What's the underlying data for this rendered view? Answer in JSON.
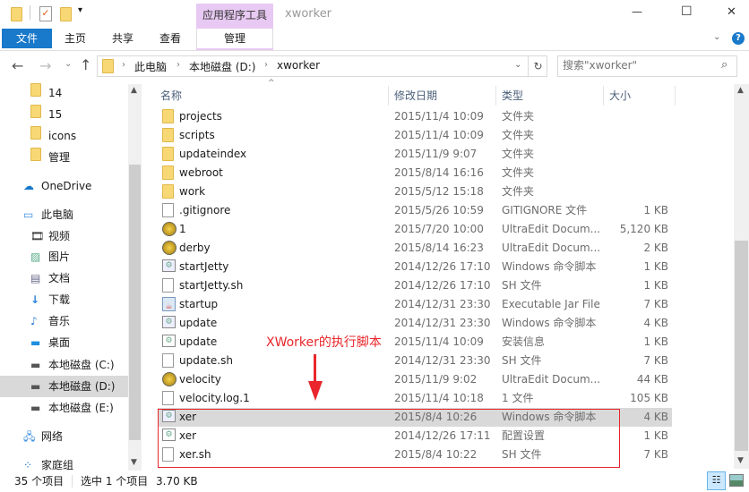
{
  "window": {
    "title": "xworker",
    "context_tab_group": "应用程序工具",
    "minimize": "—",
    "maximize": "☐",
    "close": "✕"
  },
  "ribbon": {
    "tabs": [
      {
        "label": "文件"
      },
      {
        "label": "主页"
      },
      {
        "label": "共享"
      },
      {
        "label": "查看"
      },
      {
        "label": "管理"
      }
    ]
  },
  "address": {
    "crumbs": [
      "此电脑",
      "本地磁盘 (D:)",
      "xworker"
    ],
    "search_placeholder": "搜索\"xworker\""
  },
  "nav": {
    "items": [
      {
        "label": "14",
        "icon": "folder"
      },
      {
        "label": "15",
        "icon": "folder"
      },
      {
        "label": "icons",
        "icon": "folder"
      },
      {
        "label": "管理",
        "icon": "folder"
      },
      {
        "label": "OneDrive",
        "icon": "cloud"
      },
      {
        "label": "此电脑",
        "icon": "computer"
      },
      {
        "label": "视频",
        "icon": "video"
      },
      {
        "label": "图片",
        "icon": "pictures"
      },
      {
        "label": "文档",
        "icon": "documents"
      },
      {
        "label": "下载",
        "icon": "download"
      },
      {
        "label": "音乐",
        "icon": "music"
      },
      {
        "label": "桌面",
        "icon": "desktop"
      },
      {
        "label": "本地磁盘 (C:)",
        "icon": "drive"
      },
      {
        "label": "本地磁盘 (D:)",
        "icon": "drive",
        "selected": true
      },
      {
        "label": "本地磁盘 (E:)",
        "icon": "drive"
      },
      {
        "label": "网络",
        "icon": "network"
      },
      {
        "label": "家庭组",
        "icon": "homegroup"
      }
    ]
  },
  "columns": {
    "name": "名称",
    "date": "修改日期",
    "type": "类型",
    "size": "大小"
  },
  "files": [
    {
      "name": "projects",
      "date": "2015/11/4 10:09",
      "type": "文件夹",
      "size": "",
      "icon": "folder"
    },
    {
      "name": "scripts",
      "date": "2015/11/4 10:09",
      "type": "文件夹",
      "size": "",
      "icon": "folder"
    },
    {
      "name": "updateindex",
      "date": "2015/11/9 9:07",
      "type": "文件夹",
      "size": "",
      "icon": "folder"
    },
    {
      "name": "webroot",
      "date": "2015/8/14 16:16",
      "type": "文件夹",
      "size": "",
      "icon": "folder"
    },
    {
      "name": "work",
      "date": "2015/5/12 15:18",
      "type": "文件夹",
      "size": "",
      "icon": "folder"
    },
    {
      "name": ".gitignore",
      "date": "2015/5/26 10:59",
      "type": "GITIGNORE 文件",
      "size": "1 KB",
      "icon": "file"
    },
    {
      "name": "1",
      "date": "2015/7/20 10:00",
      "type": "UltraEdit Docum...",
      "size": "5,120 KB",
      "icon": "ultraedit"
    },
    {
      "name": "derby",
      "date": "2015/8/14 16:23",
      "type": "UltraEdit Docum...",
      "size": "2 KB",
      "icon": "ultraedit"
    },
    {
      "name": "startJetty",
      "date": "2014/12/26 17:10",
      "type": "Windows 命令脚本",
      "size": "1 KB",
      "icon": "script"
    },
    {
      "name": "startJetty.sh",
      "date": "2014/12/26 17:10",
      "type": "SH 文件",
      "size": "1 KB",
      "icon": "file"
    },
    {
      "name": "startup",
      "date": "2014/12/31 23:30",
      "type": "Executable Jar File",
      "size": "7 KB",
      "icon": "jar"
    },
    {
      "name": "update",
      "date": "2014/12/31 23:30",
      "type": "Windows 命令脚本",
      "size": "4 KB",
      "icon": "script"
    },
    {
      "name": "update",
      "date": "2015/11/4 10:09",
      "type": "安装信息",
      "size": "1 KB",
      "icon": "settings"
    },
    {
      "name": "update.sh",
      "date": "2014/12/31 23:30",
      "type": "SH 文件",
      "size": "7 KB",
      "icon": "file"
    },
    {
      "name": "velocity",
      "date": "2015/11/9 9:02",
      "type": "UltraEdit Docum...",
      "size": "44 KB",
      "icon": "ultraedit"
    },
    {
      "name": "velocity.log.1",
      "date": "2015/11/4 10:18",
      "type": "1 文件",
      "size": "105 KB",
      "icon": "file"
    },
    {
      "name": "xer",
      "date": "2015/8/4 10:26",
      "type": "Windows 命令脚本",
      "size": "4 KB",
      "icon": "script",
      "selected": true
    },
    {
      "name": "xer",
      "date": "2014/12/26 17:11",
      "type": "配置设置",
      "size": "1 KB",
      "icon": "settings"
    },
    {
      "name": "xer.sh",
      "date": "2015/8/4 10:22",
      "type": "SH 文件",
      "size": "7 KB",
      "icon": "file"
    }
  ],
  "annotation": {
    "text": "XWorker的执行脚本",
    "color": "#e8262b"
  },
  "status": {
    "count": "35 个项目",
    "selected": "选中 1 个项目",
    "size": "3.70 KB"
  },
  "colors": {
    "accent": "#1979ca",
    "context_tab": "#e8c9f3",
    "selection": "#d9d9d9"
  }
}
